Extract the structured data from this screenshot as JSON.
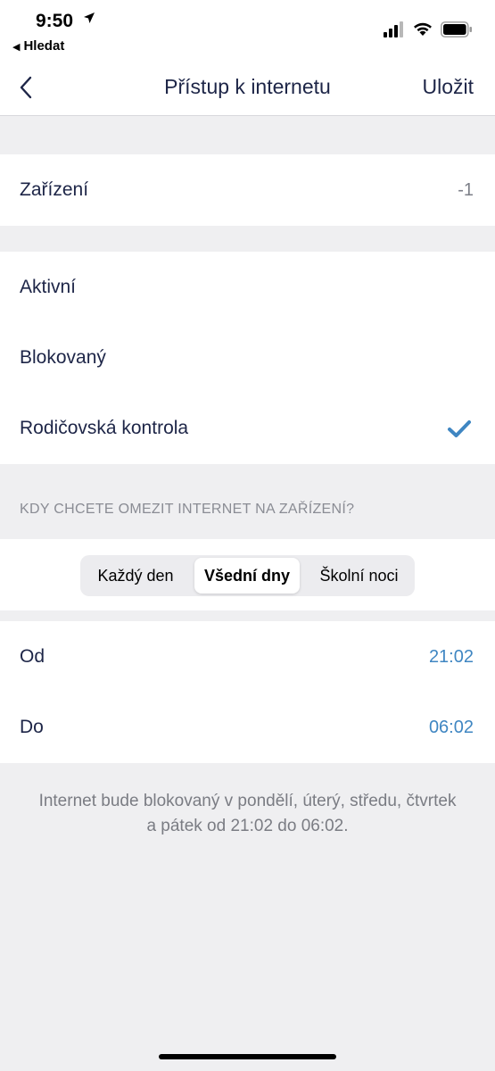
{
  "status_bar": {
    "time": "9:50",
    "back_app": "Hledat",
    "location_icon": "location-arrow-icon",
    "signal_icon": "cellular-signal-icon",
    "wifi_icon": "wifi-icon",
    "battery_icon": "battery-icon"
  },
  "nav": {
    "title": "Přístup k internetu",
    "save_label": "Uložit",
    "back_icon": "chevron-left-icon"
  },
  "device": {
    "label": "Zařízení",
    "value": "-1"
  },
  "access_modes": [
    {
      "label": "Aktivní",
      "selected": false
    },
    {
      "label": "Blokovaný",
      "selected": false
    },
    {
      "label": "Rodičovská kontrola",
      "selected": true
    }
  ],
  "schedule": {
    "header": "KDY CHCETE OMEZIT INTERNET NA ZAŘÍZENÍ?",
    "segments": [
      {
        "label": "Každý den",
        "selected": false
      },
      {
        "label": "Všední dny",
        "selected": true
      },
      {
        "label": "Školní noci",
        "selected": false
      }
    ],
    "from_label": "Od",
    "from_value": "21:02",
    "to_label": "Do",
    "to_value": "06:02",
    "note": "Internet bude blokovaný v pondělí, úterý, středu, čtvrtek a pátek od 21:02 do 06:02."
  },
  "colors": {
    "accent": "#3f86c2",
    "text": "#1d2547",
    "background": "#efeff1"
  }
}
